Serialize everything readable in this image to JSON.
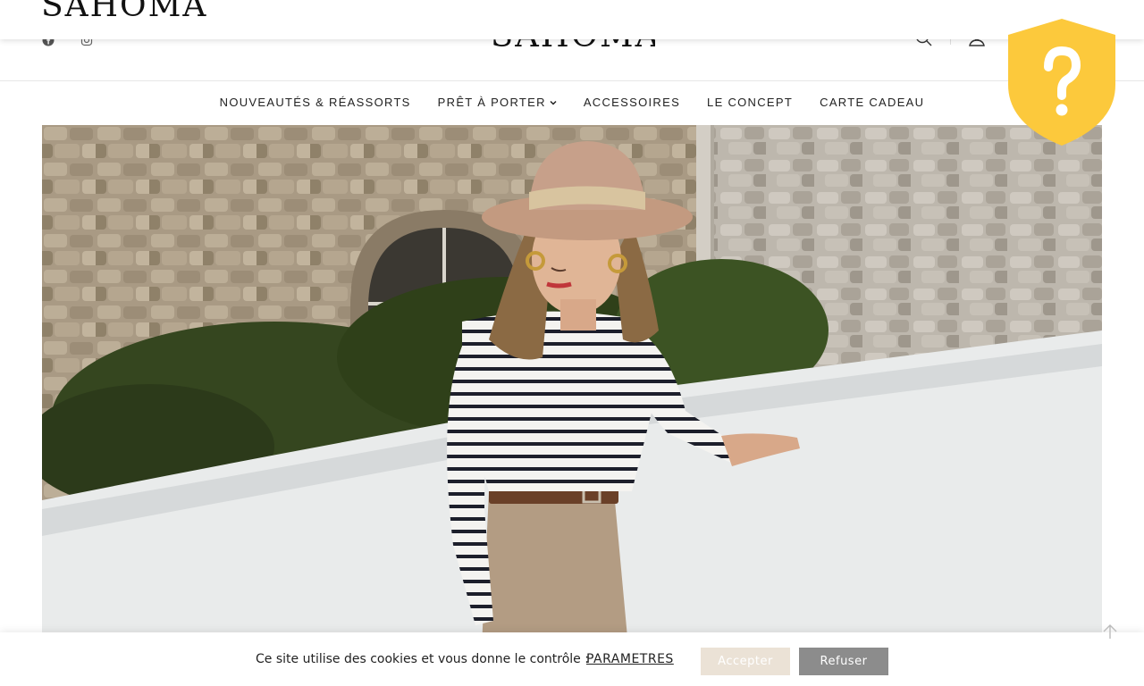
{
  "brand": {
    "logo_text": "SAHOMA"
  },
  "header": {
    "social": [
      {
        "name": "facebook-icon"
      },
      {
        "name": "instagram-icon"
      }
    ],
    "icons": [
      "search-icon",
      "user-icon"
    ]
  },
  "nav": {
    "items": [
      {
        "label": "NOUVEAUTÉS & RÉASSORTS"
      },
      {
        "label": "PRÊT À PORTER",
        "has_dropdown": true
      },
      {
        "label": "ACCESSOIRES"
      },
      {
        "label": "LE CONCEPT"
      },
      {
        "label": "CARTE CADEAU"
      }
    ]
  },
  "hero": {
    "image": "woman-in-striped-top-and-hat"
  },
  "help_badge": {
    "icon": "question-shield-icon",
    "color": "#FCC93C"
  },
  "cookie": {
    "text": "Ce site utilise des cookies et vous donne le contrôle :",
    "settings_link": "PARAMETRES",
    "accept_label": "Accepter",
    "refuse_label": "Refuser",
    "accept_color": "#EBE2D6",
    "refuse_color": "#8C8C8C"
  }
}
